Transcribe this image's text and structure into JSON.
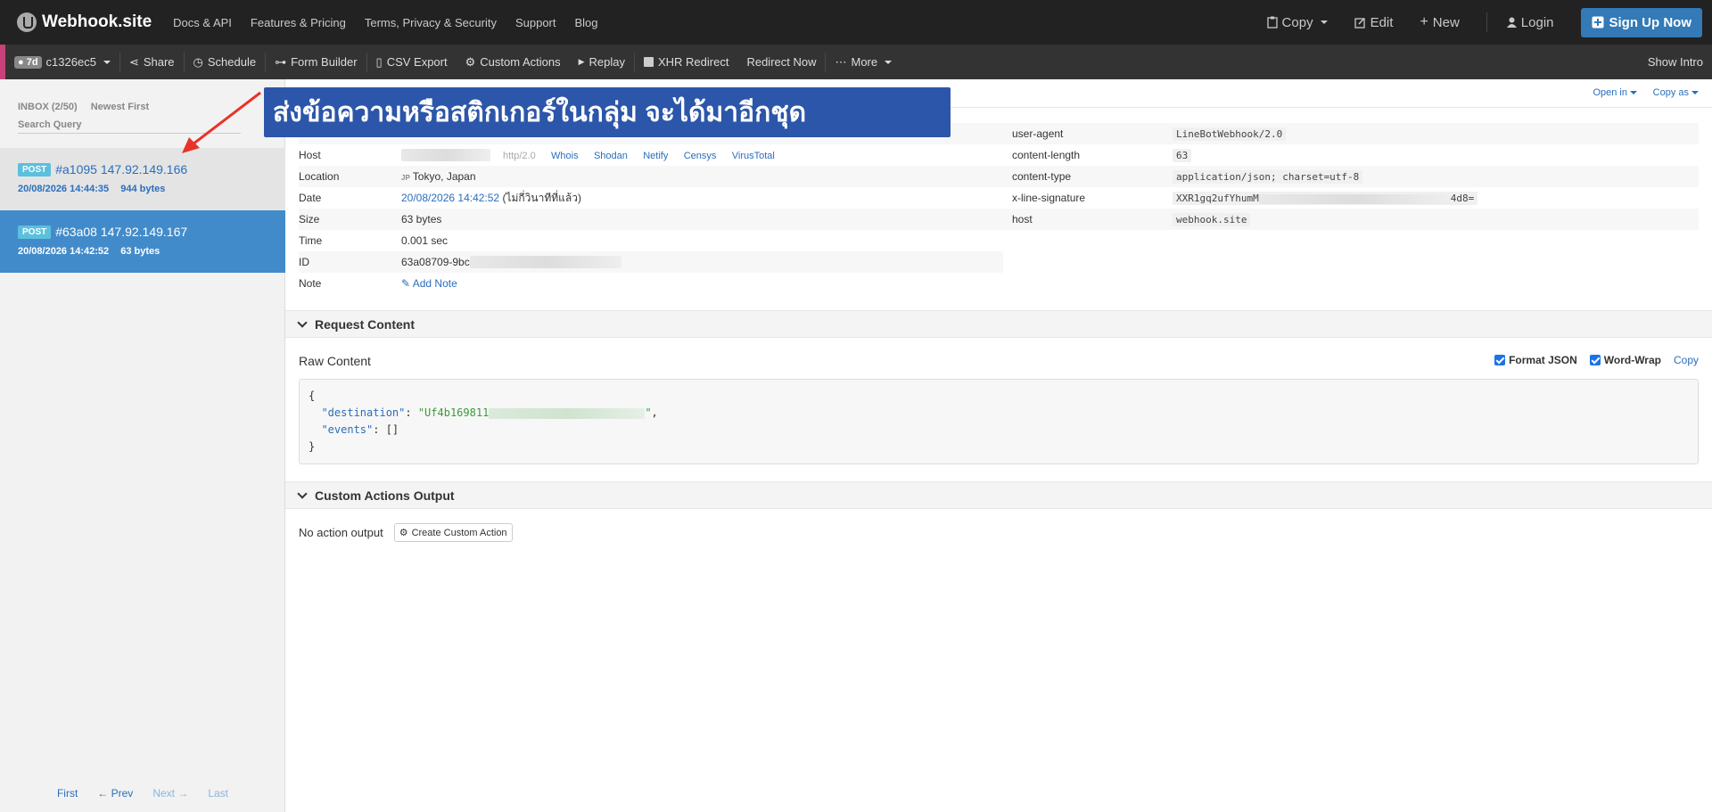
{
  "topbar": {
    "brand": "Webhook.site",
    "links": [
      "Docs & API",
      "Features & Pricing",
      "Terms, Privacy & Security",
      "Support",
      "Blog"
    ],
    "copy": "Copy",
    "edit": "Edit",
    "new": "New",
    "login": "Login",
    "signup": "Sign Up Now"
  },
  "toolbar": {
    "age": "7d",
    "token": "c1326ec5",
    "share": "Share",
    "schedule": "Schedule",
    "form_builder": "Form Builder",
    "csv_export": "CSV Export",
    "custom_actions": "Custom Actions",
    "replay": "Replay",
    "xhr_redirect": "XHR Redirect",
    "redirect_now": "Redirect Now",
    "more": "More",
    "show_intro": "Show Intro"
  },
  "sidebar": {
    "inbox": "INBOX (2/50)",
    "sort": "Newest First",
    "search_placeholder": "Search Query",
    "help": "?",
    "requests": [
      {
        "method": "POST",
        "title": "#a1095 147.92.149.166",
        "date": "20/08/2026 14:44:35",
        "size": "944 bytes"
      },
      {
        "method": "POST",
        "title": "#63a08 147.92.149.167",
        "date": "20/08/2026 14:42:52",
        "size": "63 bytes"
      }
    ],
    "pager": {
      "first": "First",
      "prev": "← Prev",
      "next": "Next →",
      "last": "Last"
    }
  },
  "details": {
    "open_in": "Open in",
    "copy_as": "Copy as",
    "rows": {
      "host_label": "Host",
      "host_proto": "http/2.0",
      "host_links": [
        "Whois",
        "Shodan",
        "Netify",
        "Censys",
        "VirusTotal"
      ],
      "location_label": "Location",
      "location_flag": "JP",
      "location": "Tokyo, Japan",
      "date_label": "Date",
      "date": "20/08/2026 14:42:52",
      "date_rel": "(ไม่กี่วินาทีที่แล้ว)",
      "size_label": "Size",
      "size": "63 bytes",
      "time_label": "Time",
      "time": "0.001 sec",
      "id_label": "ID",
      "id": "63a08709-9bc",
      "note_label": "Note",
      "note_action": "Add Note"
    },
    "headers": [
      {
        "key": "user-agent",
        "value": "LineBotWebhook/2.0"
      },
      {
        "key": "content-length",
        "value": "63"
      },
      {
        "key": "content-type",
        "value": "application/json; charset=utf-8"
      },
      {
        "key": "x-line-signature",
        "value_start": "XXR1gq2ufYhumM",
        "value_end": "4d8="
      },
      {
        "key": "host",
        "value": "webhook.site"
      }
    ]
  },
  "request_content": {
    "section": "Request Content",
    "raw_title": "Raw Content",
    "format_json": "Format JSON",
    "word_wrap": "Word-Wrap",
    "copy": "Copy",
    "json_open": "{",
    "key_destination": "\"destination\"",
    "val_destination_start": "\"Uf4b169811",
    "val_destination_end": "\"",
    "key_events": "\"events\"",
    "val_events": "[]",
    "json_close": "}"
  },
  "custom_actions": {
    "section": "Custom Actions Output",
    "no_output": "No action output",
    "create": "Create Custom Action"
  },
  "overlay": {
    "banner": "ส่งข้อความหรือสติกเกอร์ในกลุ่ม จะได้มาอีกชุด",
    "arrow_color": "#e8332a",
    "banner_color": "#2c56a9"
  }
}
